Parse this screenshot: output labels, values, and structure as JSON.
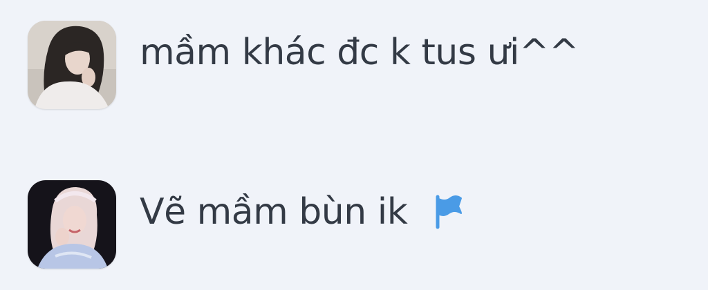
{
  "comments": [
    {
      "text": "mầm khác đc k tus ưi^^",
      "avatar_icon": "user-avatar-photo",
      "show_flag": false
    },
    {
      "text": "Vẽ mầm bùn ik",
      "avatar_icon": "user-avatar-photo",
      "show_flag": true,
      "flag_icon": "flag-icon",
      "flag_color": "#4a9be6"
    }
  ],
  "colors": {
    "background": "#f0f3f9",
    "text": "#333a45",
    "accent": "#4a9be6"
  }
}
